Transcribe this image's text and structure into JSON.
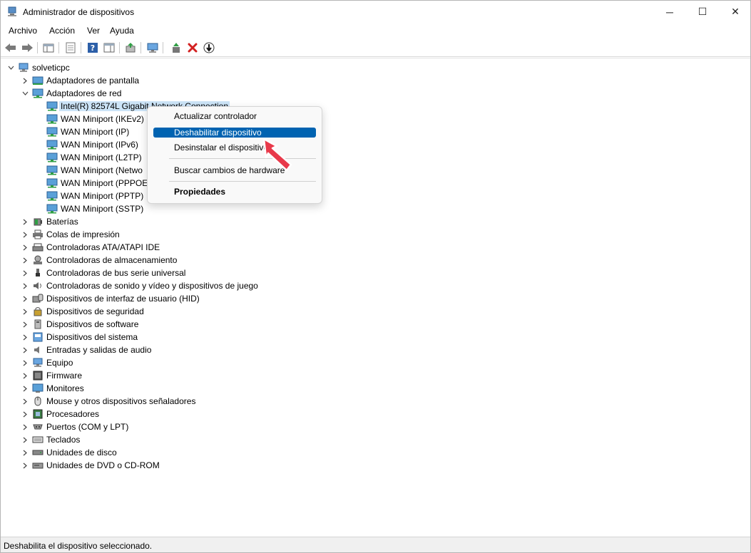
{
  "window": {
    "title": "Administrador de dispositivos",
    "buttons": {
      "minimize": "─",
      "maximize": "☐",
      "close": "✕"
    }
  },
  "menu": [
    "Archivo",
    "Acción",
    "Ver",
    "Ayuda"
  ],
  "toolbar": {
    "buttons": [
      "back-icon",
      "forward-icon",
      "show-hide-console-tree-icon",
      "properties-icon",
      "help-icon",
      "action-pane-icon",
      "update-driver-icon",
      "scan-hardware-icon",
      "enable-device-icon",
      "uninstall-device-icon",
      "disable-device-icon"
    ]
  },
  "tree": {
    "root": "solveticpc",
    "nodes": [
      {
        "label": "Adaptadores de pantalla",
        "icon": "display-adapter-icon",
        "expanded": false
      },
      {
        "label": "Adaptadores de red",
        "icon": "network-adapter-icon",
        "expanded": true,
        "children": [
          "Intel(R) 82574L Gigabit Network Connection",
          "WAN Miniport (IKEv2)",
          "WAN Miniport (IP)",
          "WAN Miniport (IPv6)",
          "WAN Miniport (L2TP)",
          "WAN Miniport (Netwo",
          "WAN Miniport (PPPOE",
          "WAN Miniport (PPTP)",
          "WAN Miniport (SSTP)"
        ]
      },
      {
        "label": "Baterías",
        "icon": "battery-icon"
      },
      {
        "label": "Colas de impresión",
        "icon": "printer-icon"
      },
      {
        "label": "Controladoras ATA/ATAPI IDE",
        "icon": "ide-controller-icon"
      },
      {
        "label": "Controladoras de almacenamiento",
        "icon": "storage-controller-icon"
      },
      {
        "label": "Controladoras de bus serie universal",
        "icon": "usb-icon"
      },
      {
        "label": "Controladoras de sonido y vídeo y dispositivos de juego",
        "icon": "sound-icon"
      },
      {
        "label": "Dispositivos de interfaz de usuario (HID)",
        "icon": "hid-icon"
      },
      {
        "label": "Dispositivos de seguridad",
        "icon": "security-device-icon"
      },
      {
        "label": "Dispositivos de software",
        "icon": "software-device-icon"
      },
      {
        "label": "Dispositivos del sistema",
        "icon": "system-device-icon"
      },
      {
        "label": "Entradas y salidas de audio",
        "icon": "audio-io-icon"
      },
      {
        "label": "Equipo",
        "icon": "computer-icon"
      },
      {
        "label": "Firmware",
        "icon": "firmware-icon"
      },
      {
        "label": "Monitores",
        "icon": "monitor-icon"
      },
      {
        "label": "Mouse y otros dispositivos señaladores",
        "icon": "mouse-icon"
      },
      {
        "label": "Procesadores",
        "icon": "processor-icon"
      },
      {
        "label": "Puertos (COM y LPT)",
        "icon": "port-icon"
      },
      {
        "label": "Teclados",
        "icon": "keyboard-icon"
      },
      {
        "label": "Unidades de disco",
        "icon": "disk-drive-icon"
      },
      {
        "label": "Unidades de DVD o CD-ROM",
        "icon": "dvd-drive-icon"
      }
    ]
  },
  "context_menu": {
    "items": [
      "Actualizar controlador",
      "Deshabilitar dispositivo",
      "Desinstalar el dispositivo",
      "Buscar cambios de hardware",
      "Propiedades"
    ],
    "highlighted": "Deshabilitar dispositivo"
  },
  "status": "Deshabilita el dispositivo seleccionado.",
  "colors": {
    "accent": "#0063b1",
    "selection": "#cce4f7",
    "cursor": "#e8394a"
  }
}
